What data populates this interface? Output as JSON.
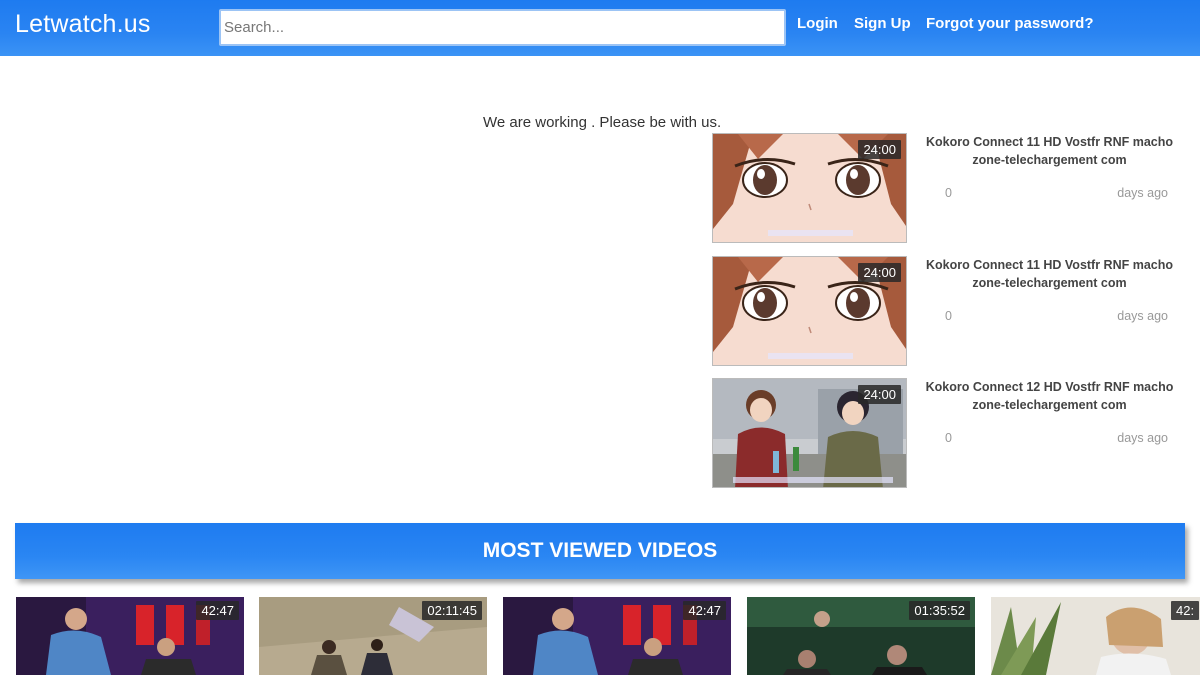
{
  "header": {
    "brand": "Letwatch.us",
    "search_placeholder": "Search...",
    "links": [
      {
        "label": "Login"
      },
      {
        "label": "Sign Up"
      },
      {
        "label": "Forgot your password?"
      }
    ]
  },
  "notice": "We are working . Please be with us.",
  "side_videos": [
    {
      "title": "Kokoro Connect 11 HD Vostfr RNF macho zone-telechargement com",
      "duration": "24:00",
      "views": "0",
      "age": "days ago",
      "scene": "anime-eyes"
    },
    {
      "title": "Kokoro Connect 11 HD Vostfr RNF macho zone-telechargement com",
      "duration": "24:00",
      "views": "0",
      "age": "days ago",
      "scene": "anime-eyes"
    },
    {
      "title": "Kokoro Connect 12 HD Vostfr RNF macho zone-telechargement com",
      "duration": "24:00",
      "views": "0",
      "age": "days ago",
      "scene": "anime-two"
    }
  ],
  "most_viewed": {
    "heading": "MOST VIEWED VIDEOS",
    "videos": [
      {
        "duration": "42:47"
      },
      {
        "duration": "02:11:45"
      },
      {
        "duration": "42:47"
      },
      {
        "duration": "01:35:52"
      },
      {
        "duration": "42:"
      }
    ]
  },
  "colors": {
    "header_blue": "#2a84f2",
    "banner_blue": "#2a86f3"
  }
}
